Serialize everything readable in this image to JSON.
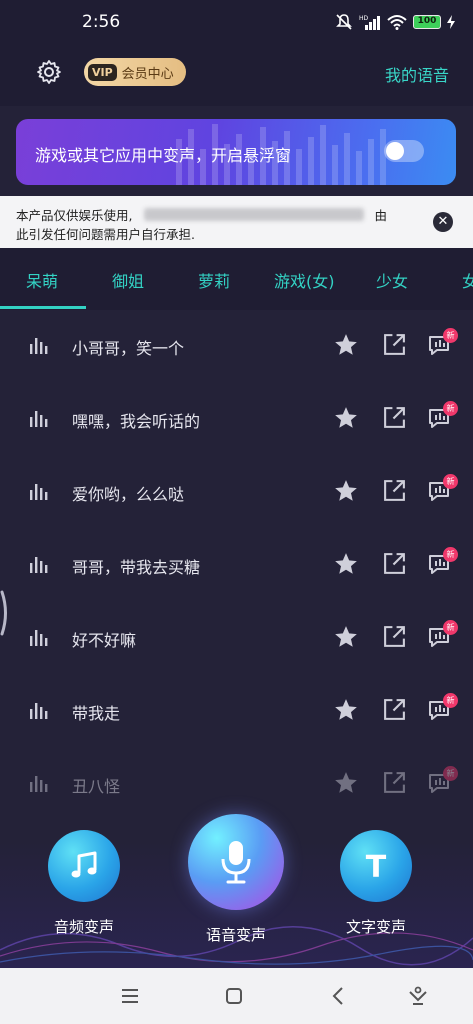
{
  "status_bar": {
    "time": "2:56",
    "battery": "100",
    "network_badge": "HD"
  },
  "header": {
    "vip_tag": "VIP",
    "vip_label": "会员中心",
    "my_voice": "我的语音"
  },
  "banner": {
    "text": "游戏或其它应用中变声，开启悬浮窗",
    "toggle_on": false
  },
  "disclaimer": {
    "line1_prefix": "本产品仅供娱乐使用,",
    "line1_suffix": "由",
    "line2": "此引发任何问题需用户自行承担."
  },
  "tabs": [
    {
      "label": "呆萌",
      "active": true
    },
    {
      "label": "御姐",
      "active": false
    },
    {
      "label": "萝莉",
      "active": false
    },
    {
      "label": "游戏(女)",
      "active": false
    },
    {
      "label": "少女",
      "active": false
    },
    {
      "label": "女",
      "active": false
    }
  ],
  "voice_list": [
    {
      "title": "小哥哥，笑一个",
      "badge": "新"
    },
    {
      "title": "嘿嘿，我会听话的",
      "badge": "新"
    },
    {
      "title": "爱你哟，么么哒",
      "badge": "新"
    },
    {
      "title": "哥哥，带我去买糖",
      "badge": "新"
    },
    {
      "title": "好不好嘛",
      "badge": "新"
    },
    {
      "title": "带我走",
      "badge": "新"
    },
    {
      "title": "丑八怪",
      "badge": "新"
    }
  ],
  "actions": {
    "audio": "音频变声",
    "voice": "语音变声",
    "text": "文字变声",
    "text_icon_letter": "T"
  },
  "colors": {
    "accent": "#33d2c4",
    "background": "#242238",
    "badge": "#f0386b",
    "vip_gold": "#e4bd82"
  },
  "icons": {
    "settings": "gear-icon",
    "row_leading": "sound-wave-icon",
    "favorite": "star-icon",
    "share": "external-link-icon",
    "voice_bubble": "voice-bubble-icon",
    "audio_action": "music-note-icon",
    "voice_action": "microphone-icon",
    "nav": [
      "menu-icon",
      "home-square-icon",
      "back-icon",
      "assistant-icon"
    ]
  }
}
